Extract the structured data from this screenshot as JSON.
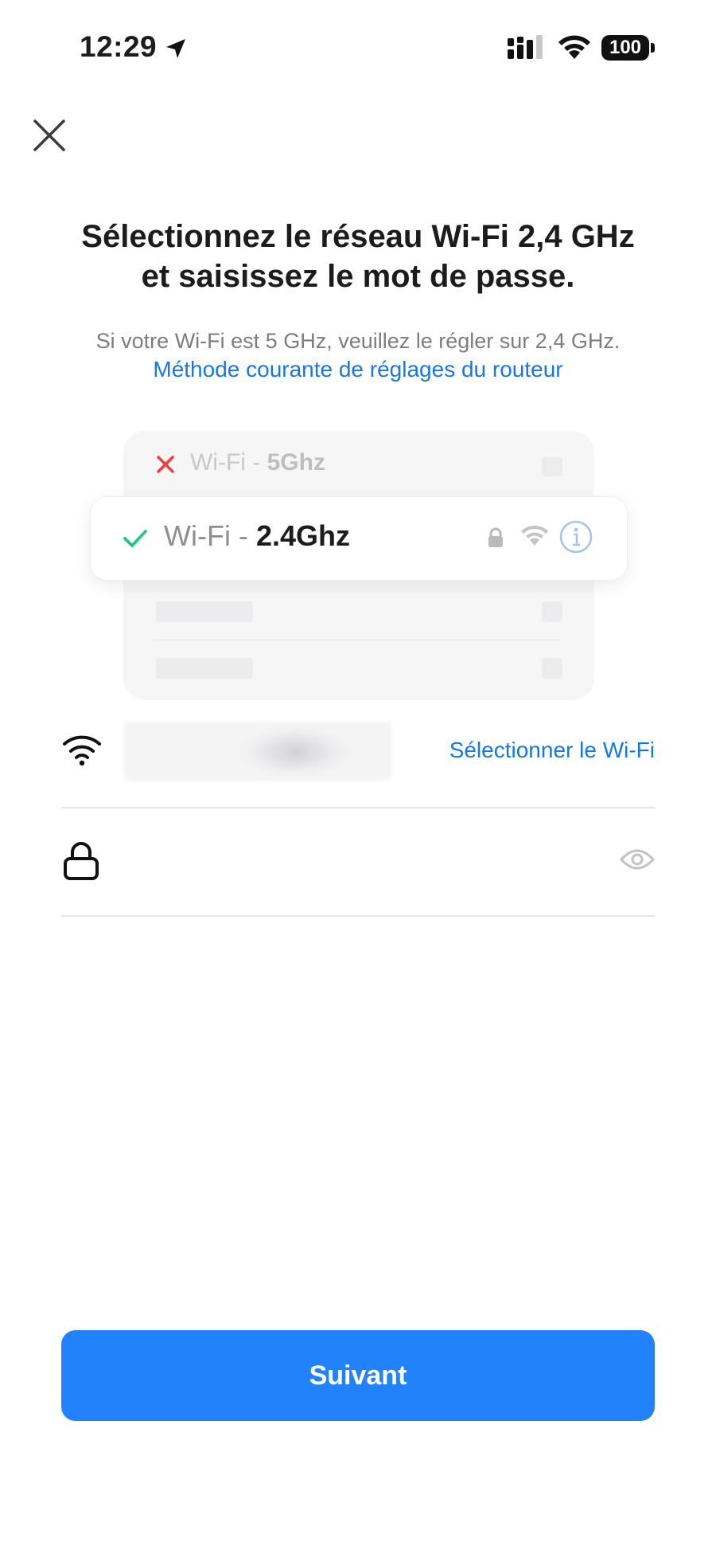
{
  "status_bar": {
    "time": "12:29",
    "battery": "100",
    "icons": [
      "location-arrow-icon",
      "cellular-signal-icon",
      "wifi-icon",
      "battery-icon"
    ]
  },
  "close_icon": "close-icon",
  "heading": {
    "title_line1": "Sélectionnez le réseau Wi-Fi 2,4 GHz",
    "title_line2": "et saisissez le mot de passe.",
    "subtitle": "Si votre Wi-Fi est 5 GHz, veuillez le régler sur 2,4 GHz.",
    "link": "Méthode courante de réglages du routeur"
  },
  "illustration": {
    "bad_network": {
      "prefix": "Wi-Fi - ",
      "band": "5Ghz",
      "status_icon": "cross-icon"
    },
    "good_network": {
      "prefix": "Wi-Fi - ",
      "band": "2.4Ghz",
      "status_icon": "check-icon",
      "trailing_icons": [
        "lock-icon",
        "wifi-icon",
        "info-icon"
      ]
    }
  },
  "form": {
    "wifi_field": {
      "icon": "wifi-icon",
      "select_label": "Sélectionner le Wi-Fi"
    },
    "password_field": {
      "icon": "lock-icon",
      "value": "",
      "placeholder": "",
      "toggle_icon": "eye-icon"
    }
  },
  "next_button": {
    "label": "Suivant"
  },
  "colors": {
    "accent": "#2182fb",
    "link": "#1677e8",
    "success": "#1fc78a",
    "error": "#f23b3b"
  }
}
